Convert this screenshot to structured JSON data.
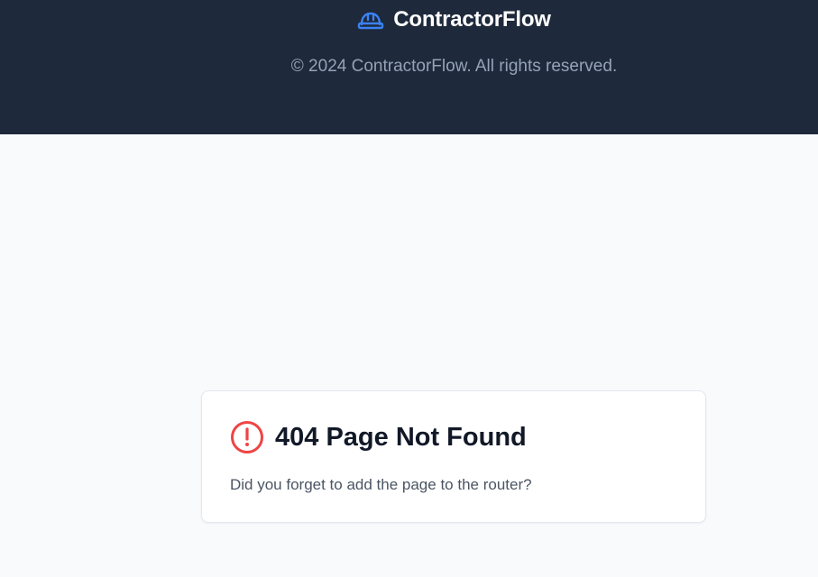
{
  "header": {
    "brand_name": "ContractorFlow",
    "brand_icon": "hard-hat-icon",
    "copyright": "© 2024 ContractorFlow. All rights reserved."
  },
  "error_card": {
    "icon": "alert-circle-icon",
    "title": "404 Page Not Found",
    "message": "Did you forget to add the page to the router?"
  },
  "colors": {
    "header_bg": "#1e293b",
    "brand_icon": "#3b82f6",
    "alert_icon": "#ef4444",
    "page_bg": "#f8fafc"
  }
}
